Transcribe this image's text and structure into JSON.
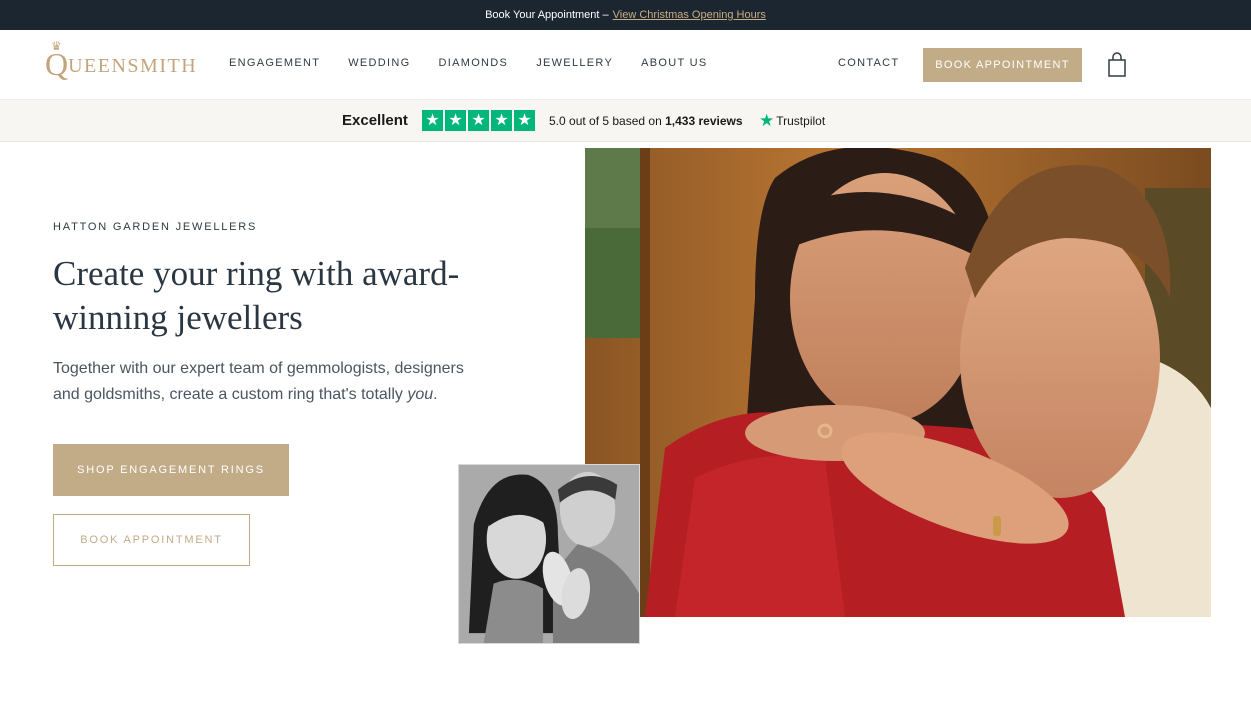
{
  "announcement": {
    "text": "Book Your Appointment –",
    "link": "View Christmas Opening Hours"
  },
  "header": {
    "logo_initial": "Q",
    "logo_rest": "UEENSMITH",
    "nav": [
      "ENGAGEMENT",
      "WEDDING",
      "DIAMONDS",
      "JEWELLERY",
      "ABOUT US"
    ],
    "contact": "CONTACT",
    "book_button": "BOOK APPOINTMENT",
    "cart_icon": "shopping-bag-icon"
  },
  "trustpilot": {
    "rating_word": "Excellent",
    "stars": 5,
    "score_text": "5.0 out of 5 based on",
    "reviews": "1,433 reviews",
    "brand": "Trustpilot",
    "color": "#00b67a"
  },
  "hero": {
    "eyebrow": "HATTON GARDEN JEWELLERS",
    "headline": "Create your ring with award-winning jewellers",
    "description_main": "Together with our expert team of gemmologists, designers and goldsmiths, create a custom ring that's totally",
    "description_emphasis": "you",
    "description_end": ".",
    "primary_cta": "SHOP ENGAGEMENT RINGS",
    "secondary_cta": "BOOK APPOINTMENT"
  },
  "colors": {
    "accent": "#c2ab87",
    "dark": "#1c2630",
    "text": "#2a3641"
  }
}
